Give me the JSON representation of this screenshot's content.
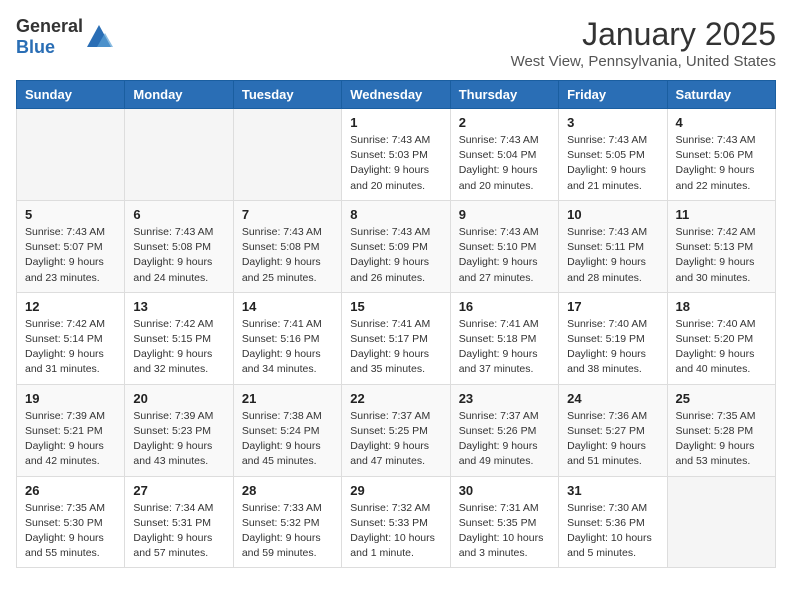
{
  "logo": {
    "general": "General",
    "blue": "Blue"
  },
  "header": {
    "month": "January 2025",
    "location": "West View, Pennsylvania, United States"
  },
  "weekdays": [
    "Sunday",
    "Monday",
    "Tuesday",
    "Wednesday",
    "Thursday",
    "Friday",
    "Saturday"
  ],
  "weeks": [
    [
      {
        "day": "",
        "info": ""
      },
      {
        "day": "",
        "info": ""
      },
      {
        "day": "",
        "info": ""
      },
      {
        "day": "1",
        "info": "Sunrise: 7:43 AM\nSunset: 5:03 PM\nDaylight: 9 hours\nand 20 minutes."
      },
      {
        "day": "2",
        "info": "Sunrise: 7:43 AM\nSunset: 5:04 PM\nDaylight: 9 hours\nand 20 minutes."
      },
      {
        "day": "3",
        "info": "Sunrise: 7:43 AM\nSunset: 5:05 PM\nDaylight: 9 hours\nand 21 minutes."
      },
      {
        "day": "4",
        "info": "Sunrise: 7:43 AM\nSunset: 5:06 PM\nDaylight: 9 hours\nand 22 minutes."
      }
    ],
    [
      {
        "day": "5",
        "info": "Sunrise: 7:43 AM\nSunset: 5:07 PM\nDaylight: 9 hours\nand 23 minutes."
      },
      {
        "day": "6",
        "info": "Sunrise: 7:43 AM\nSunset: 5:08 PM\nDaylight: 9 hours\nand 24 minutes."
      },
      {
        "day": "7",
        "info": "Sunrise: 7:43 AM\nSunset: 5:08 PM\nDaylight: 9 hours\nand 25 minutes."
      },
      {
        "day": "8",
        "info": "Sunrise: 7:43 AM\nSunset: 5:09 PM\nDaylight: 9 hours\nand 26 minutes."
      },
      {
        "day": "9",
        "info": "Sunrise: 7:43 AM\nSunset: 5:10 PM\nDaylight: 9 hours\nand 27 minutes."
      },
      {
        "day": "10",
        "info": "Sunrise: 7:43 AM\nSunset: 5:11 PM\nDaylight: 9 hours\nand 28 minutes."
      },
      {
        "day": "11",
        "info": "Sunrise: 7:42 AM\nSunset: 5:13 PM\nDaylight: 9 hours\nand 30 minutes."
      }
    ],
    [
      {
        "day": "12",
        "info": "Sunrise: 7:42 AM\nSunset: 5:14 PM\nDaylight: 9 hours\nand 31 minutes."
      },
      {
        "day": "13",
        "info": "Sunrise: 7:42 AM\nSunset: 5:15 PM\nDaylight: 9 hours\nand 32 minutes."
      },
      {
        "day": "14",
        "info": "Sunrise: 7:41 AM\nSunset: 5:16 PM\nDaylight: 9 hours\nand 34 minutes."
      },
      {
        "day": "15",
        "info": "Sunrise: 7:41 AM\nSunset: 5:17 PM\nDaylight: 9 hours\nand 35 minutes."
      },
      {
        "day": "16",
        "info": "Sunrise: 7:41 AM\nSunset: 5:18 PM\nDaylight: 9 hours\nand 37 minutes."
      },
      {
        "day": "17",
        "info": "Sunrise: 7:40 AM\nSunset: 5:19 PM\nDaylight: 9 hours\nand 38 minutes."
      },
      {
        "day": "18",
        "info": "Sunrise: 7:40 AM\nSunset: 5:20 PM\nDaylight: 9 hours\nand 40 minutes."
      }
    ],
    [
      {
        "day": "19",
        "info": "Sunrise: 7:39 AM\nSunset: 5:21 PM\nDaylight: 9 hours\nand 42 minutes."
      },
      {
        "day": "20",
        "info": "Sunrise: 7:39 AM\nSunset: 5:23 PM\nDaylight: 9 hours\nand 43 minutes."
      },
      {
        "day": "21",
        "info": "Sunrise: 7:38 AM\nSunset: 5:24 PM\nDaylight: 9 hours\nand 45 minutes."
      },
      {
        "day": "22",
        "info": "Sunrise: 7:37 AM\nSunset: 5:25 PM\nDaylight: 9 hours\nand 47 minutes."
      },
      {
        "day": "23",
        "info": "Sunrise: 7:37 AM\nSunset: 5:26 PM\nDaylight: 9 hours\nand 49 minutes."
      },
      {
        "day": "24",
        "info": "Sunrise: 7:36 AM\nSunset: 5:27 PM\nDaylight: 9 hours\nand 51 minutes."
      },
      {
        "day": "25",
        "info": "Sunrise: 7:35 AM\nSunset: 5:28 PM\nDaylight: 9 hours\nand 53 minutes."
      }
    ],
    [
      {
        "day": "26",
        "info": "Sunrise: 7:35 AM\nSunset: 5:30 PM\nDaylight: 9 hours\nand 55 minutes."
      },
      {
        "day": "27",
        "info": "Sunrise: 7:34 AM\nSunset: 5:31 PM\nDaylight: 9 hours\nand 57 minutes."
      },
      {
        "day": "28",
        "info": "Sunrise: 7:33 AM\nSunset: 5:32 PM\nDaylight: 9 hours\nand 59 minutes."
      },
      {
        "day": "29",
        "info": "Sunrise: 7:32 AM\nSunset: 5:33 PM\nDaylight: 10 hours\nand 1 minute."
      },
      {
        "day": "30",
        "info": "Sunrise: 7:31 AM\nSunset: 5:35 PM\nDaylight: 10 hours\nand 3 minutes."
      },
      {
        "day": "31",
        "info": "Sunrise: 7:30 AM\nSunset: 5:36 PM\nDaylight: 10 hours\nand 5 minutes."
      },
      {
        "day": "",
        "info": ""
      }
    ]
  ]
}
